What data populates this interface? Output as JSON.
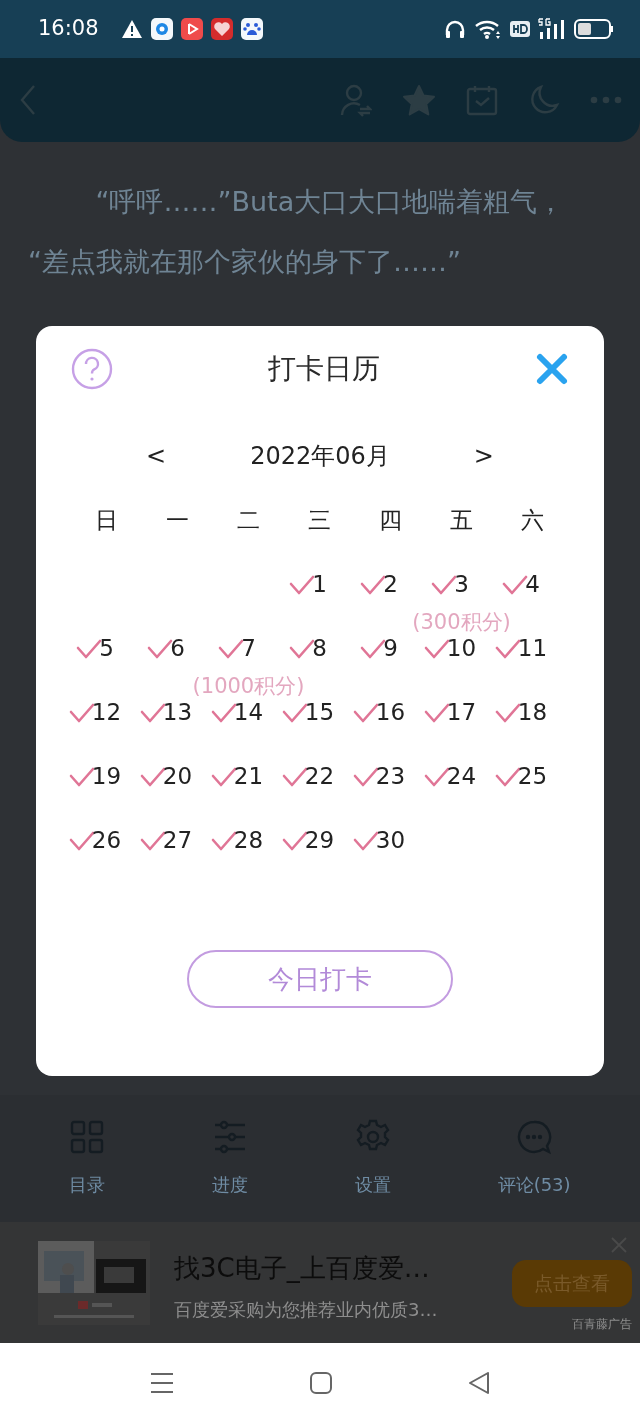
{
  "status_bar": {
    "time": "16:08"
  },
  "paragraphs": [
    "“呼呼……”Buta大口大口地喘着粗气，",
    "“差点我就在那个家伙的身下了……”"
  ],
  "dialog": {
    "title": "打卡日历",
    "prev": "<",
    "month": "2022年06月",
    "next": ">",
    "weekdays": [
      "日",
      "一",
      "二",
      "三",
      "四",
      "五",
      "六"
    ],
    "weeks": [
      {
        "right_aligned": true,
        "days": [
          {
            "day": "1",
            "checked": true
          },
          {
            "day": "2",
            "checked": true
          },
          {
            "day": "3",
            "checked": true,
            "reward": "(300积分)"
          },
          {
            "day": "4",
            "checked": true
          }
        ]
      },
      {
        "days": [
          {
            "day": "5",
            "checked": true
          },
          {
            "day": "6",
            "checked": true
          },
          {
            "day": "7",
            "checked": true,
            "reward": "(1000积分)"
          },
          {
            "day": "8",
            "checked": true
          },
          {
            "day": "9",
            "checked": true
          },
          {
            "day": "10",
            "checked": true
          },
          {
            "day": "11",
            "checked": true
          }
        ]
      },
      {
        "days": [
          {
            "day": "12",
            "checked": true
          },
          {
            "day": "13",
            "checked": true
          },
          {
            "day": "14",
            "checked": true
          },
          {
            "day": "15",
            "checked": true
          },
          {
            "day": "16",
            "checked": true
          },
          {
            "day": "17",
            "checked": true
          },
          {
            "day": "18",
            "checked": true
          }
        ]
      },
      {
        "days": [
          {
            "day": "19",
            "checked": true
          },
          {
            "day": "20",
            "checked": true
          },
          {
            "day": "21",
            "checked": true
          },
          {
            "day": "22",
            "checked": true
          },
          {
            "day": "23",
            "checked": true
          },
          {
            "day": "24",
            "checked": true
          },
          {
            "day": "25",
            "checked": true
          }
        ]
      },
      {
        "days": [
          {
            "day": "26",
            "checked": true
          },
          {
            "day": "27",
            "checked": true
          },
          {
            "day": "28",
            "checked": true
          },
          {
            "day": "29",
            "checked": true
          },
          {
            "day": "30",
            "checked": true
          }
        ]
      }
    ],
    "button": "今日打卡"
  },
  "bottom_nav": [
    {
      "kind": "grid",
      "label": "目录"
    },
    {
      "kind": "sliders",
      "label": "进度"
    },
    {
      "kind": "gear",
      "label": "设置"
    },
    {
      "kind": "chat",
      "label": "评论(53)"
    }
  ],
  "ad": {
    "title": "找3C电子_上百度爱…",
    "description": "百度爱采购为您推荐业内优质3…",
    "button": "点击查看",
    "source": "百青藤广告"
  }
}
